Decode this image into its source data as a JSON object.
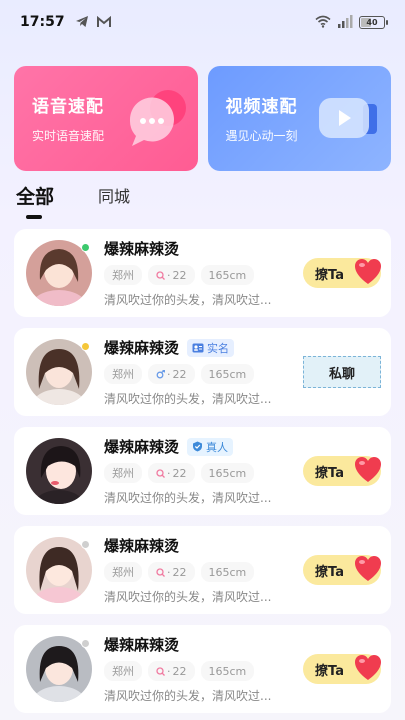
{
  "status_bar": {
    "time": "17:57",
    "battery": "40"
  },
  "match_cards": [
    {
      "title": "语音速配",
      "subtitle": "实时语音速配"
    },
    {
      "title": "视频速配",
      "subtitle": "遇见心动一刻"
    }
  ],
  "tabs": [
    {
      "label": "全部"
    },
    {
      "label": "同城"
    }
  ],
  "users": [
    {
      "name": "爆辣麻辣烫",
      "badge": "",
      "city": "郑州",
      "age": "22",
      "height": "165cm",
      "bio": "清风吹过你的头发，清风吹过...",
      "action": "撩Ta",
      "online_color": "#3cc96d"
    },
    {
      "name": "爆辣麻辣烫",
      "badge": "实名",
      "city": "郑州",
      "age": "22",
      "height": "165cm",
      "bio": "清风吹过你的头发，清风吹过...",
      "action": "私聊",
      "online_color": "#f5c73a"
    },
    {
      "name": "爆辣麻辣烫",
      "badge": "真人",
      "city": "郑州",
      "age": "22",
      "height": "165cm",
      "bio": "清风吹过你的头发，清风吹过...",
      "action": "撩Ta",
      "online_color": ""
    },
    {
      "name": "爆辣麻辣烫",
      "badge": "",
      "city": "郑州",
      "age": "22",
      "height": "165cm",
      "bio": "清风吹过你的头发，清风吹过...",
      "action": "撩Ta",
      "online_color": "#cfcfcf"
    },
    {
      "name": "爆辣麻辣烫",
      "badge": "",
      "city": "郑州",
      "age": "22",
      "height": "165cm",
      "bio": "清风吹过你的头发，清风吹过...",
      "action": "撩Ta",
      "online_color": "#cfcfcf"
    }
  ],
  "colors": {
    "voice": "#ff5c93",
    "video": "#6d9bff",
    "flirt": "#fbe99d",
    "heart": "#f03c4f"
  }
}
